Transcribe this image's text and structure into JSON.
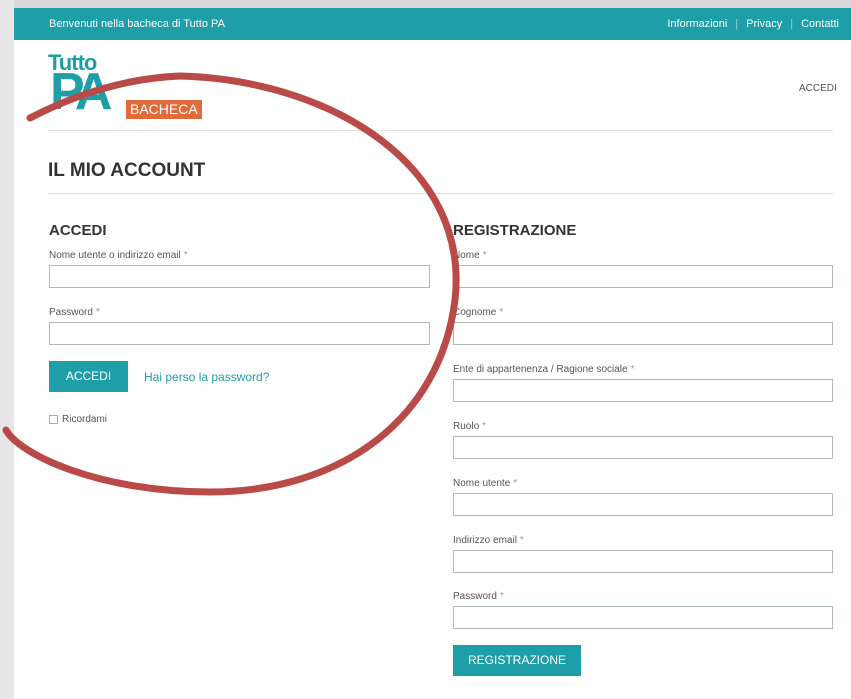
{
  "topbar": {
    "welcome": "Benvenuti nella bacheca di Tutto PA",
    "links": [
      "Informazioni",
      "Privacy",
      "Contatti"
    ]
  },
  "logo": {
    "line1": "Tutto",
    "line2": "PA",
    "badge": "BACHECA"
  },
  "nav": {
    "login": "ACCEDI"
  },
  "page_title": "IL MIO ACCOUNT",
  "login": {
    "title": "ACCEDI",
    "username_label": "Nome utente o indirizzo email",
    "password_label": "Password",
    "required_mark": "*",
    "submit": "ACCEDI",
    "lost_password": "Hai perso la password?",
    "remember": "Ricordami"
  },
  "register": {
    "title": "REGISTRAZIONE",
    "fields": [
      "Nome",
      "Cognome",
      "Ente di appartenenza / Ragione sociale",
      "Ruolo",
      "Nome utente",
      "Indirizzo email",
      "Password"
    ],
    "required_mark": "*",
    "submit": "REGISTRAZIONE"
  },
  "colors": {
    "accent": "#1e9ea6",
    "badge": "#e06a3a",
    "annotation": "#b94a48"
  }
}
